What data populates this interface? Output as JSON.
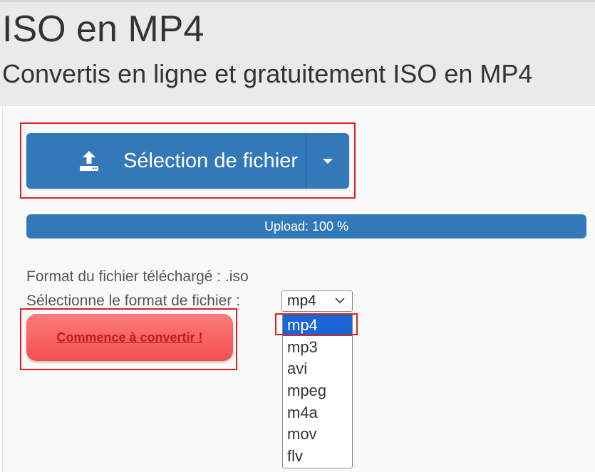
{
  "header": {
    "title": "ISO en MP4",
    "subtitle": "Convertis en ligne et gratuitement ISO en MP4"
  },
  "upload": {
    "button_label": "Sélection de fichier",
    "icon": "upload-icon",
    "toggle_icon": "caret-down-icon"
  },
  "progress": {
    "label": "Upload: 100 %",
    "percent": 100
  },
  "file_info": {
    "uploaded_format": "Format du fichier téléchargé : .iso",
    "select_label": "Sélectionne le format de fichier :"
  },
  "format_select": {
    "value": "mp4",
    "options": [
      "mp4",
      "mp3",
      "avi",
      "mpeg",
      "m4a",
      "mov",
      "flv"
    ],
    "selected_index": 0
  },
  "convert": {
    "label": "Commence à convertir !"
  },
  "colors": {
    "primary": "#3379b9",
    "convert_button": "#f76464",
    "convert_text": "#b8201f",
    "highlight": "#e02020",
    "option_selected": "#1a66d2"
  }
}
